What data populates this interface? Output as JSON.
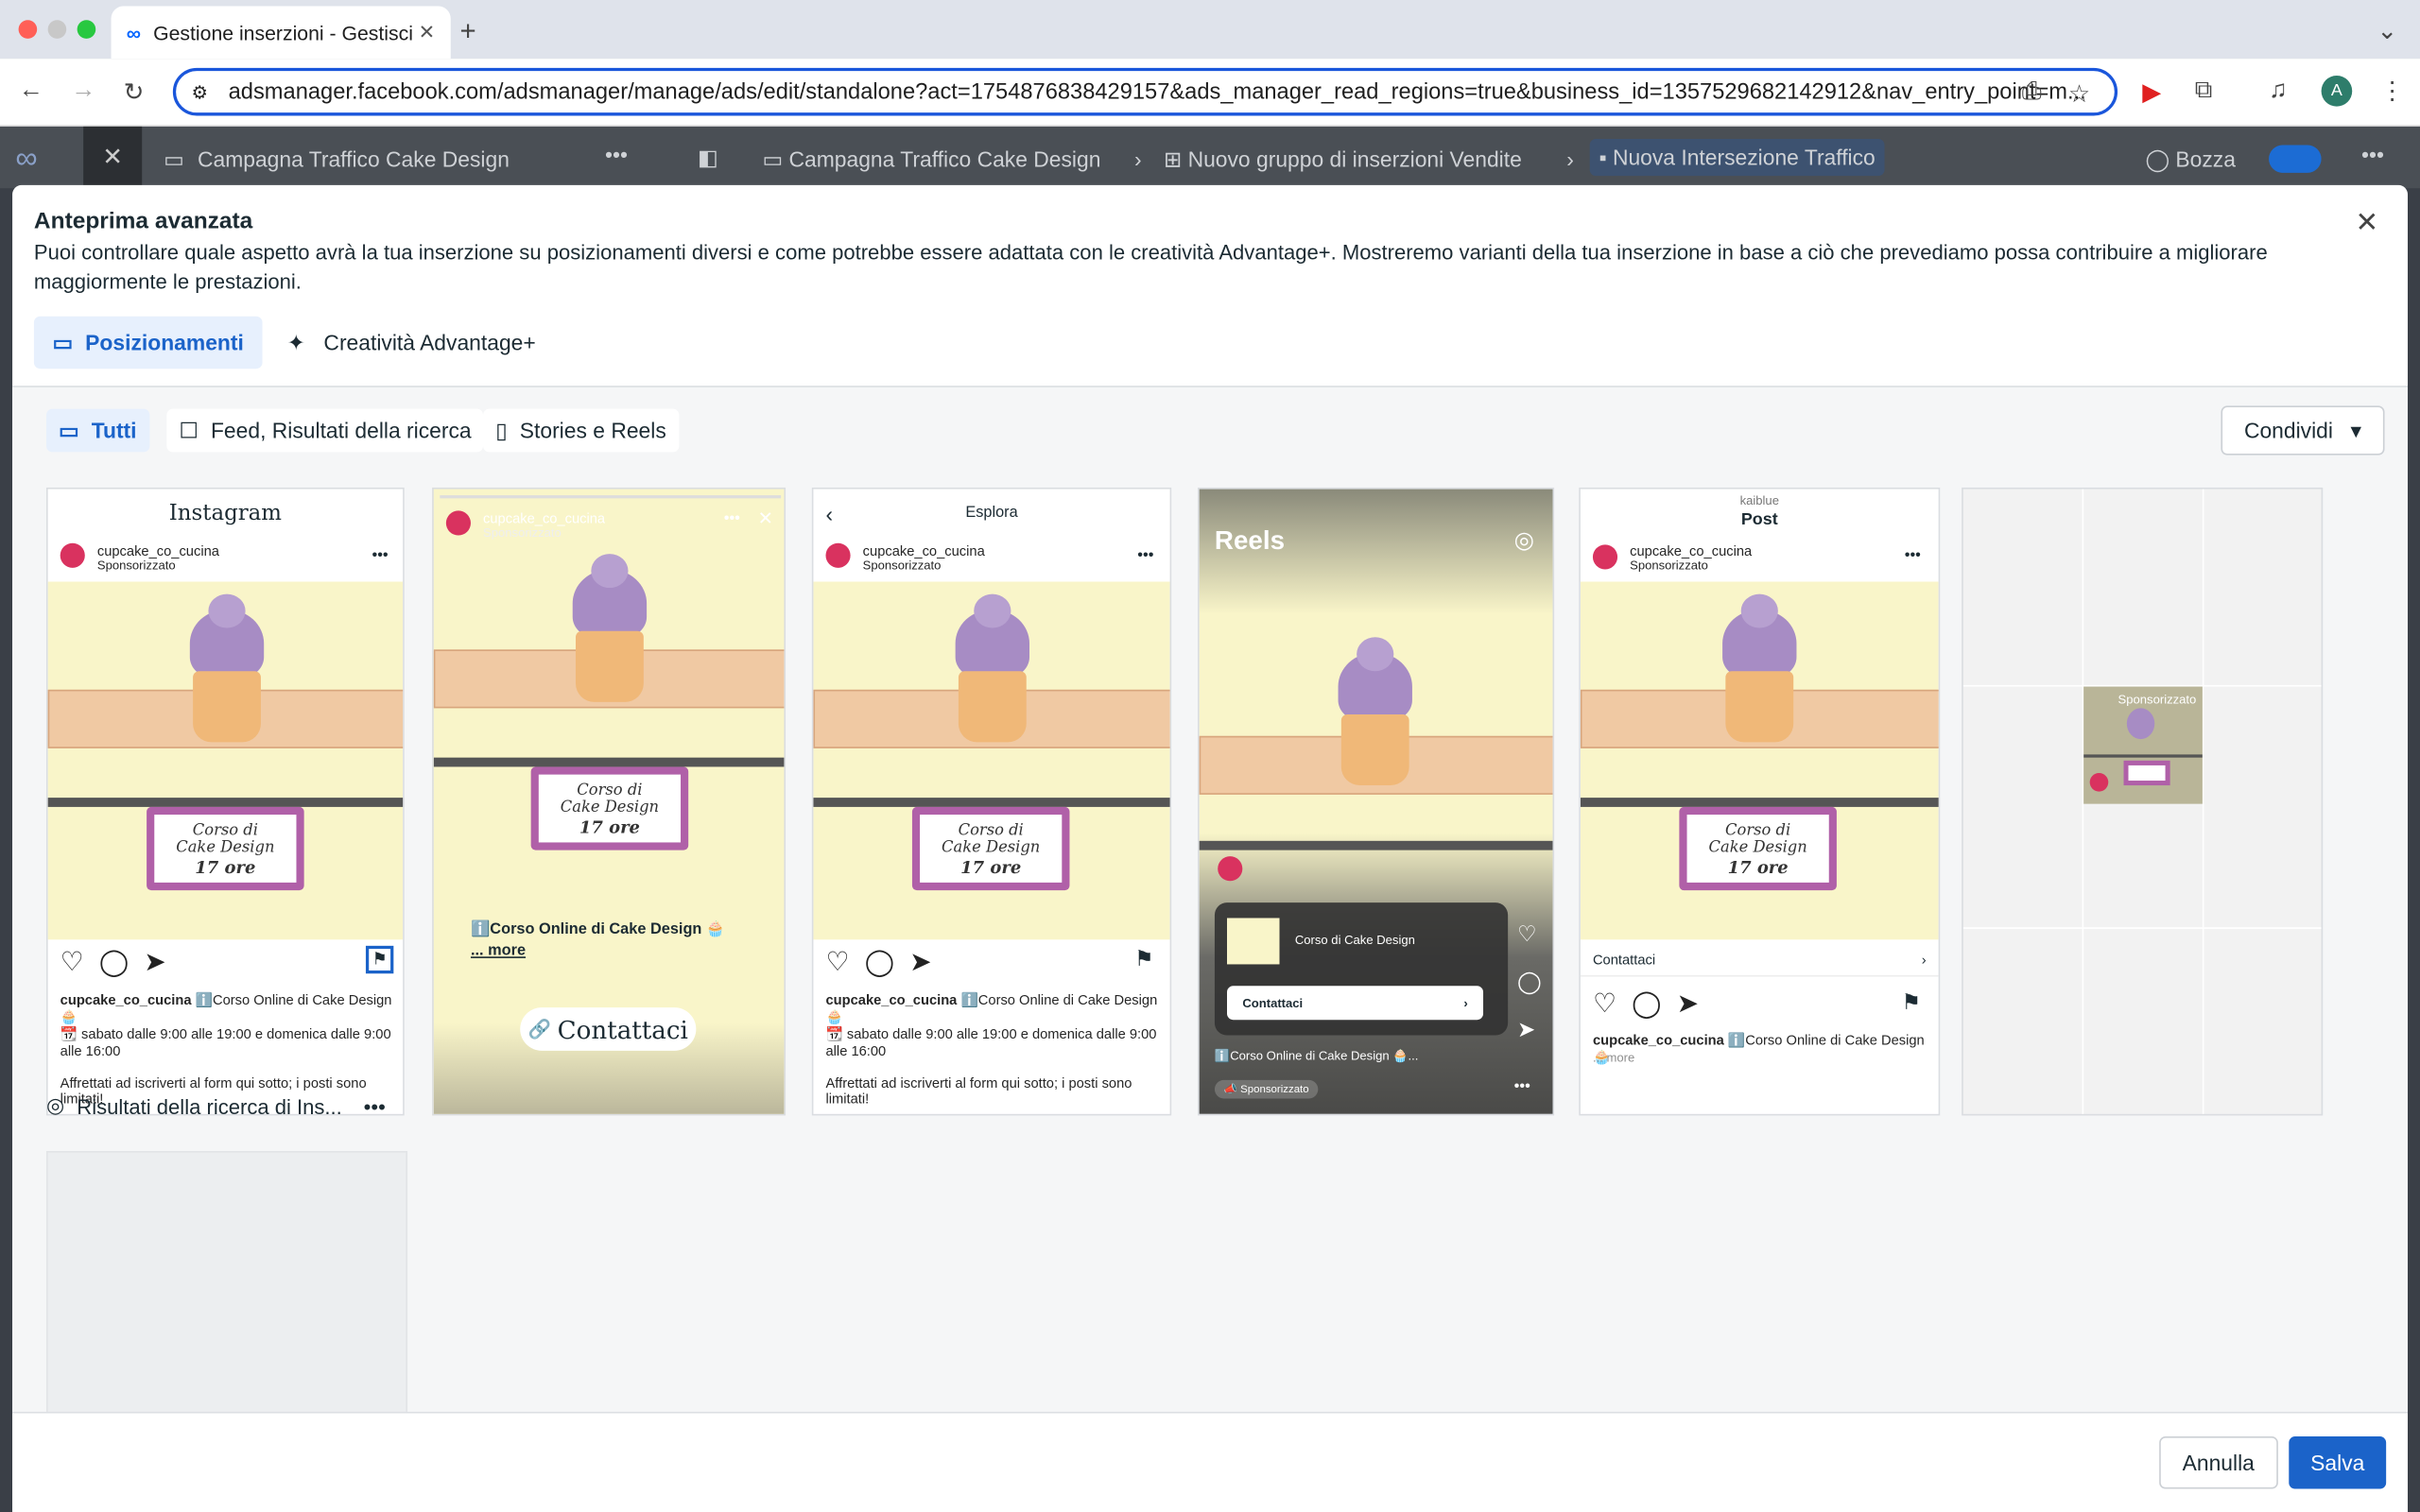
{
  "browser": {
    "tab_title": "Gestione inserzioni - Gestisci",
    "url": "adsmanager.facebook.com/adsmanager/manage/ads/edit/standalone?act=1754876838429157&ads_manager_read_regions=true&business_id=1357529682142912&nav_entry_point=m...",
    "avatar": "A"
  },
  "appbar": {
    "campaign": "Campagna Traffico Cake Design",
    "bc1": "Campagna Traffico Cake Design",
    "bc2": "Nuovo gruppo di inserzioni Vendite",
    "bc3": "Nuova Intersezione Traffico",
    "status": "Bozza"
  },
  "modal": {
    "title": "Anteprima avanzata",
    "description": "Puoi controllare quale aspetto avrà la tua inserzione su posizionamenti diversi e come potrebbe essere adattata con le creatività Advantage+. Mostreremo varianti della tua inserzione in base a ciò che prevediamo possa contribuire a migliorare maggiormente le prestazioni.",
    "tabs": [
      "Posizionamenti",
      "Creatività Advantage+"
    ],
    "filters": [
      "Tutti",
      "Feed, Risultati della ricerca",
      "Stories e Reels"
    ],
    "share": "Condividi",
    "section2": "Risultati della ricerca di Ins...",
    "cancel": "Annulla",
    "save": "Salva"
  },
  "ad": {
    "account": "cupcake_co_cucina",
    "sponsored": "Sponsorizzato",
    "sign1": "Corso di",
    "sign2": "Cake Design",
    "sign3": "17 ore",
    "caption": "ℹ️Corso Online di Cake Design 🧁",
    "hours": "📆 sabato dalle 9:00 alle 19:00 e domenica dalle 9:00 alle 16:00",
    "urgency": "Affrettati ad iscriverti al form qui sotto; i posti sono limitati!",
    "story_caption": "ℹ️Corso Online di Cake Design 🧁",
    "story_more": "... more",
    "more": "more",
    "contact": "Contattaci",
    "contact_btn": "Contattaci",
    "instagram": "Instagram",
    "explore": "Esplora",
    "reels": "Reels",
    "reels_course": "Corso di Cake Design",
    "reels_caption": "ℹ️Corso Online di Cake Design 🧁...",
    "profile_user": "kaiblue",
    "post": "Post"
  }
}
